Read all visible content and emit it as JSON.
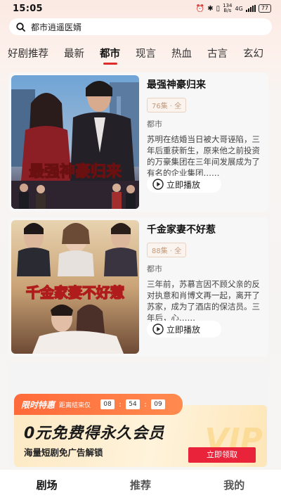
{
  "status_bar": {
    "time": "15:05",
    "net_speed_value": "134",
    "net_speed_unit": "B/s",
    "signal": "4G",
    "battery": "77"
  },
  "search": {
    "query": "都市逍遥医婿"
  },
  "tabs": [
    {
      "label": "好剧推荐",
      "active": false
    },
    {
      "label": "最新",
      "active": false
    },
    {
      "label": "都市",
      "active": true
    },
    {
      "label": "现言",
      "active": false
    },
    {
      "label": "热血",
      "active": false
    },
    {
      "label": "古言",
      "active": false
    },
    {
      "label": "玄幻",
      "active": false
    }
  ],
  "dramas": [
    {
      "title": "最强神豪归来",
      "episodes": "76集 · 全",
      "genre": "都市",
      "description": "苏明在结婚当日被大哥诬陷，三年后重获新生，原来他之前投资的万豪集团在三年间发展成为了有名的企业集团……",
      "play_label": "立即播放",
      "poster_caption": "最强神豪归来"
    },
    {
      "title": "千金家妻不好惹",
      "episodes": "88集 · 全",
      "genre": "都市",
      "description": "三年前，苏慕言因不顾父亲的反对执意和肖博文再一起，离开了苏家，成为了酒店的保洁员。三年后，心……",
      "play_label": "立即播放",
      "poster_caption": "千金家妻不好惹"
    }
  ],
  "promo": {
    "tag": "限时特惠",
    "countdown_label": "距离结束仅",
    "countdown": {
      "h": "08",
      "m": "54",
      "s": "09"
    },
    "title": "0元免费得永久会员",
    "description": "海量短剧免广告解锁",
    "watermark": "VIP",
    "button": "立即领取"
  },
  "bottom_nav": [
    {
      "label": "剧场",
      "active": true
    },
    {
      "label": "推荐",
      "active": false
    },
    {
      "label": "我的",
      "active": false
    }
  ],
  "colors": {
    "accent": "#e02b2b",
    "promo_orange": "#ff6a3a",
    "claim_red": "#e8233a"
  }
}
